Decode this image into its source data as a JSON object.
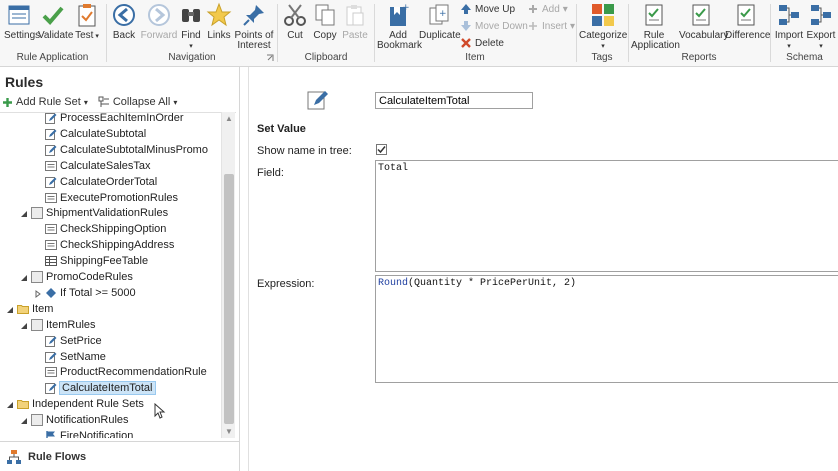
{
  "ribbon": {
    "groups": {
      "rule_application": "Rule Application",
      "navigation": "Navigation",
      "clipboard": "Clipboard",
      "item": "Item",
      "tags": "Tags",
      "reports": "Reports",
      "schema": "Schema"
    },
    "buttons": {
      "settings": "Settings",
      "validate": "Validate",
      "test": "Test",
      "back": "Back",
      "forward": "Forward",
      "find": "Find",
      "links": "Links",
      "points_of_interest_1": "Points of",
      "points_of_interest_2": "Interest",
      "cut": "Cut",
      "copy": "Copy",
      "paste": "Paste",
      "add_bookmark_1": "Add",
      "add_bookmark_2": "Bookmark",
      "duplicate": "Duplicate",
      "move_up": "Move Up",
      "move_down": "Move Down",
      "delete": "Delete",
      "add": "Add",
      "insert": "Insert",
      "categorize": "Categorize",
      "rule_application_1": "Rule",
      "rule_application_2": "Application",
      "vocabulary": "Vocabulary",
      "difference": "Difference",
      "import": "Import",
      "export": "Export"
    }
  },
  "left": {
    "title": "Rules",
    "add_rule_set": "Add Rule Set",
    "collapse_all": "Collapse All",
    "tree": [
      {
        "label": "ProcessEachItemInOrder",
        "indent": 3,
        "icon": "edit"
      },
      {
        "label": "CalculateSubtotal",
        "indent": 3,
        "icon": "edit"
      },
      {
        "label": "CalculateSubtotalMinusPromo",
        "indent": 3,
        "icon": "edit"
      },
      {
        "label": "CalculateSalesTax",
        "indent": 3,
        "icon": "rule"
      },
      {
        "label": "CalculateOrderTotal",
        "indent": 3,
        "icon": "edit"
      },
      {
        "label": "ExecutePromotionRules",
        "indent": 3,
        "icon": "rule"
      },
      {
        "label": "ShipmentValidationRules",
        "indent": 2,
        "icon": "ruleset",
        "toggle": "open"
      },
      {
        "label": "CheckShippingOption",
        "indent": 3,
        "icon": "rule"
      },
      {
        "label": "CheckShippingAddress",
        "indent": 3,
        "icon": "rule"
      },
      {
        "label": "ShippingFeeTable",
        "indent": 3,
        "icon": "table"
      },
      {
        "label": "PromoCodeRules",
        "indent": 2,
        "icon": "ruleset",
        "toggle": "open"
      },
      {
        "label": "If Total >= 5000",
        "indent": 3,
        "icon": "diamond",
        "toggle": "closed"
      },
      {
        "label": "Item",
        "indent": 1,
        "icon": "folder",
        "toggle": "open"
      },
      {
        "label": "ItemRules",
        "indent": 2,
        "icon": "ruleset",
        "toggle": "open"
      },
      {
        "label": "SetPrice",
        "indent": 3,
        "icon": "edit"
      },
      {
        "label": "SetName",
        "indent": 3,
        "icon": "edit"
      },
      {
        "label": "ProductRecommendationRule",
        "indent": 3,
        "icon": "rule"
      },
      {
        "label": "CalculateItemTotal",
        "indent": 3,
        "icon": "edit",
        "selected": true
      },
      {
        "label": "Independent Rule Sets",
        "indent": 1,
        "icon": "folder",
        "toggle": "open"
      },
      {
        "label": "NotificationRules",
        "indent": 2,
        "icon": "ruleset",
        "toggle": "open"
      },
      {
        "label": "FireNotification",
        "indent": 3,
        "icon": "flag"
      }
    ],
    "rule_flows": "Rule Flows"
  },
  "right": {
    "name_value": "CalculateItemTotal",
    "section": "Set Value",
    "show_name_label": "Show name in tree:",
    "show_name_checked": true,
    "field_label": "Field:",
    "field_value": "Total",
    "expression_label": "Expression:",
    "expression_fn": "Round",
    "expression_rest": "(Quantity * PricePerUnit, 2)"
  }
}
